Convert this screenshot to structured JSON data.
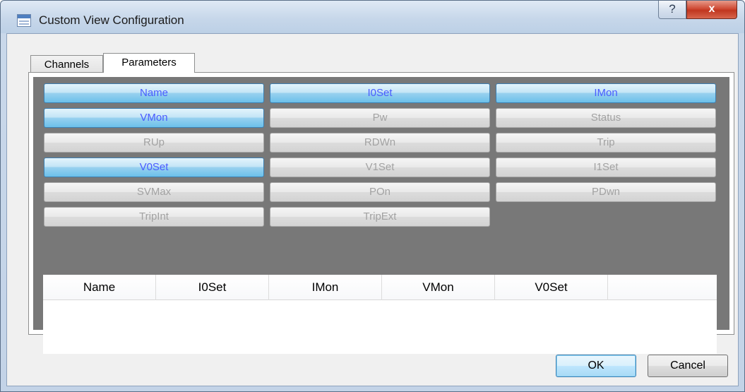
{
  "window": {
    "title": "Custom View Configuration",
    "help_label": "?",
    "close_label": "x"
  },
  "tabs": [
    {
      "label": "Channels",
      "selected": false
    },
    {
      "label": "Parameters",
      "selected": true
    }
  ],
  "parameters": [
    {
      "label": "Name",
      "checked": true
    },
    {
      "label": "I0Set",
      "checked": true
    },
    {
      "label": "IMon",
      "checked": true
    },
    {
      "label": "VMon",
      "checked": true
    },
    {
      "label": "Pw",
      "checked": false
    },
    {
      "label": "Status",
      "checked": false
    },
    {
      "label": "RUp",
      "checked": false
    },
    {
      "label": "RDWn",
      "checked": false
    },
    {
      "label": "Trip",
      "checked": false
    },
    {
      "label": "V0Set",
      "checked": true
    },
    {
      "label": "V1Set",
      "checked": false
    },
    {
      "label": "I1Set",
      "checked": false
    },
    {
      "label": "SVMax",
      "checked": false
    },
    {
      "label": "POn",
      "checked": false
    },
    {
      "label": "PDwn",
      "checked": false
    },
    {
      "label": "TripInt",
      "checked": false
    },
    {
      "label": "TripExt",
      "checked": false
    }
  ],
  "preview_table": {
    "columns": [
      "Name",
      "I0Set",
      "IMon",
      "VMon",
      "V0Set",
      ""
    ]
  },
  "buttons": {
    "ok": "OK",
    "cancel": "Cancel"
  },
  "colors": {
    "selected_button": "#98d1ef",
    "selected_text": "#4a5cff",
    "unselected_text": "#a2a2a2",
    "panel_background": "#787878"
  }
}
